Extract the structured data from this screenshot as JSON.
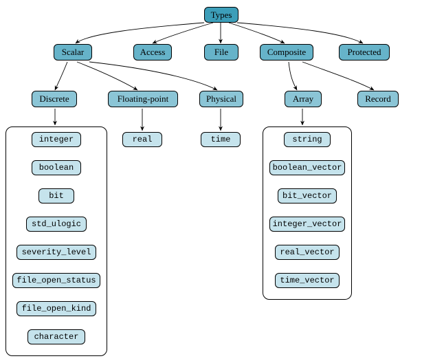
{
  "root": "Types",
  "cats": {
    "scalar": "Scalar",
    "access": "Access",
    "file": "File",
    "composite": "Composite",
    "protected": "Protected"
  },
  "subs": {
    "discrete": "Discrete",
    "floating": "Floating-point",
    "physical": "Physical",
    "array": "Array",
    "record": "Record"
  },
  "discrete_leaves": [
    "integer",
    "boolean",
    "bit",
    "std_ulogic",
    "severity_level",
    "file_open_status",
    "file_open_kind",
    "character"
  ],
  "floating_leaf": "real",
  "physical_leaf": "time",
  "array_leaves": [
    "string",
    "boolean_vector",
    "bit_vector",
    "integer_vector",
    "real_vector",
    "time_vector"
  ],
  "colors": {
    "root": "#3c9eb9",
    "cat": "#66b3c9",
    "sub": "#8bc5d6",
    "leaf": "#c5e3ec"
  },
  "chart_data": {
    "type": "tree",
    "title": "Types",
    "root": "Types",
    "children": [
      {
        "name": "Scalar",
        "children": [
          {
            "name": "Discrete",
            "children": [
              {
                "name": "integer"
              },
              {
                "name": "boolean"
              },
              {
                "name": "bit"
              },
              {
                "name": "std_ulogic"
              },
              {
                "name": "severity_level"
              },
              {
                "name": "file_open_status"
              },
              {
                "name": "file_open_kind"
              },
              {
                "name": "character"
              }
            ]
          },
          {
            "name": "Floating-point",
            "children": [
              {
                "name": "real"
              }
            ]
          },
          {
            "name": "Physical",
            "children": [
              {
                "name": "time"
              }
            ]
          }
        ]
      },
      {
        "name": "Access"
      },
      {
        "name": "File"
      },
      {
        "name": "Composite",
        "children": [
          {
            "name": "Array",
            "children": [
              {
                "name": "string"
              },
              {
                "name": "boolean_vector"
              },
              {
                "name": "bit_vector"
              },
              {
                "name": "integer_vector"
              },
              {
                "name": "real_vector"
              },
              {
                "name": "time_vector"
              }
            ]
          },
          {
            "name": "Record"
          }
        ]
      },
      {
        "name": "Protected"
      }
    ]
  }
}
